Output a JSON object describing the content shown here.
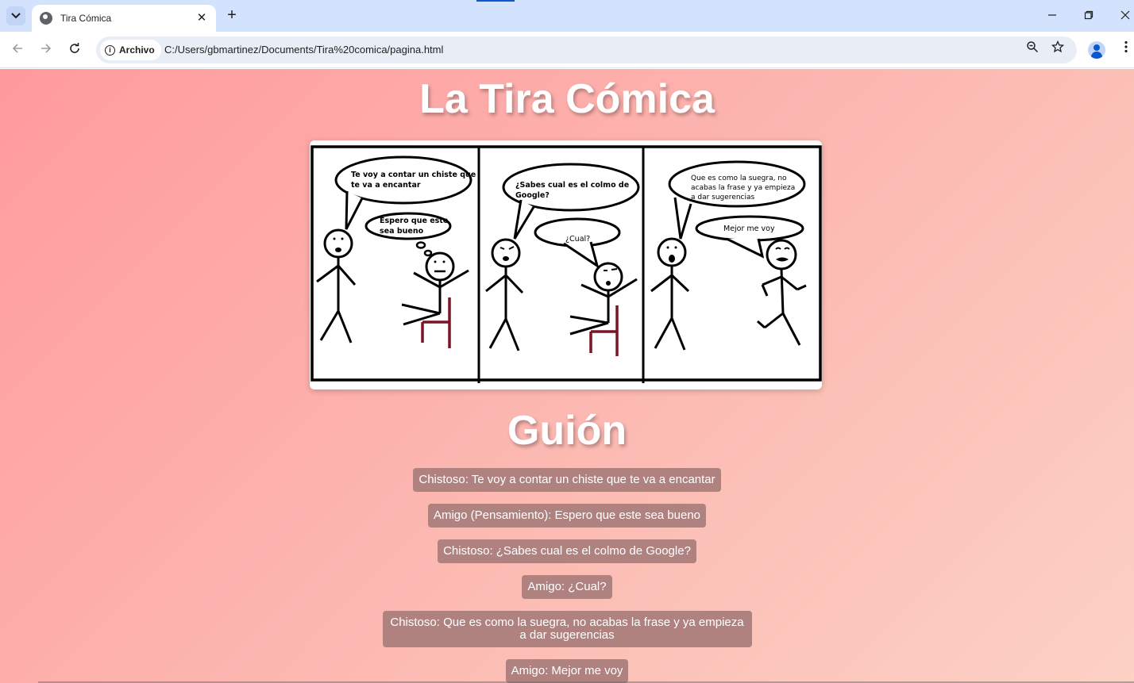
{
  "browser": {
    "tab_title": "Tira Cómica",
    "close_glyph": "✕",
    "newtab_glyph": "+",
    "security_chip": "Archivo",
    "url": "C:/Users/gbmartinez/Documents/Tira%20comica/pagina.html",
    "icons": [
      "tab-search-icon",
      "globe-icon",
      "close-icon",
      "plus-icon",
      "minimize-icon",
      "restore-icon",
      "window-close-icon",
      "back-arrow-icon",
      "forward-arrow-icon",
      "reload-icon",
      "info-icon",
      "zoom-icon",
      "star-icon",
      "profile-icon",
      "kebab-menu-icon"
    ]
  },
  "page": {
    "title": "La Tira Cómica",
    "script_heading": "Guión",
    "comic": {
      "panels": [
        {
          "speech": [
            "Te voy a contar un chiste que",
            "te va a encantar"
          ],
          "thought": [
            "Espero que este",
            "sea bueno"
          ]
        },
        {
          "speech": [
            "¿Sabes cual es el colmo de",
            "Google?"
          ],
          "reply": [
            "¿Cual?"
          ]
        },
        {
          "speech": [
            "Que es como la suegra, no",
            "acabas la frase y ya empieza",
            "a dar sugerencias"
          ],
          "reply": [
            "Mejor me voy"
          ]
        }
      ]
    },
    "script_lines": [
      "Chistoso: Te voy a contar un chiste que te va a encantar",
      "Amigo (Pensamiento): Espero que este sea bueno",
      "Chistoso: ¿Sabes cual es el colmo de Google?",
      "Amigo: ¿Cual?",
      "Chistoso: Que es como la suegra, no acabas la frase y ya empieza a dar sugerencias",
      "Amigo: Mejor me voy"
    ]
  },
  "colors": {
    "gradient_start": "#ff9a9e",
    "gradient_end": "#fdd1c6",
    "script_bubble": "#af8280",
    "chair": "#7a1426",
    "tabstrip": "#d3e3fd"
  }
}
